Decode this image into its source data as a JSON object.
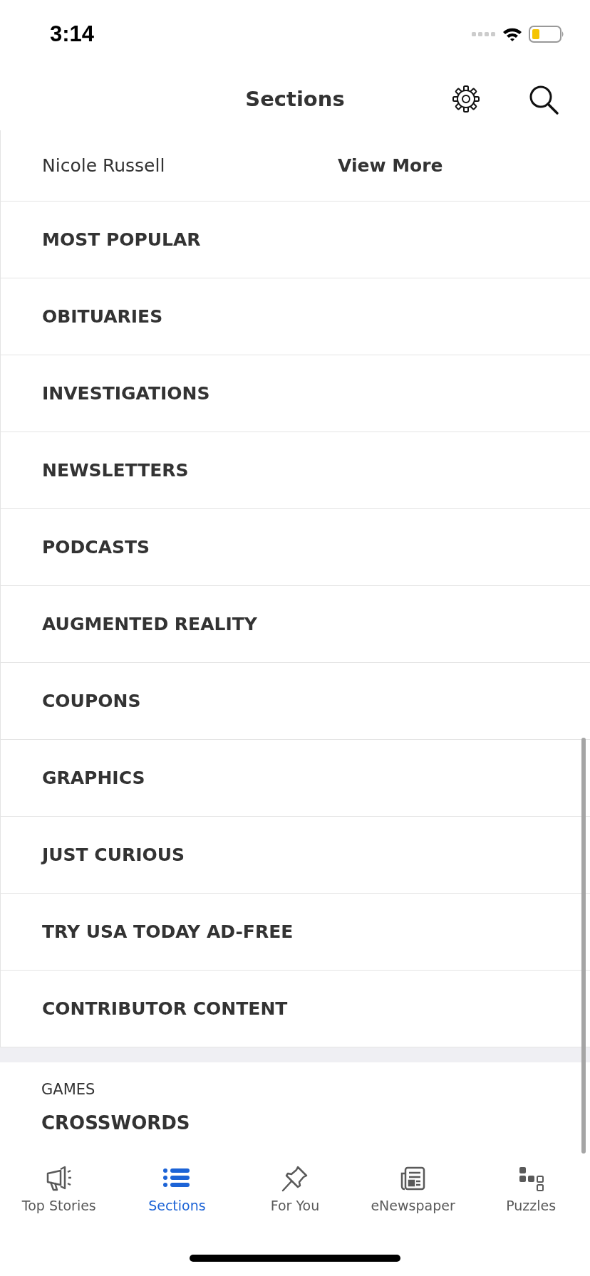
{
  "status_bar": {
    "time": "3:14"
  },
  "nav_bar": {
    "title": "Sections"
  },
  "partial_row": {
    "author": "Nicole Russell",
    "link": "View More"
  },
  "sections": [
    {
      "label": "MOST POPULAR"
    },
    {
      "label": "OBITUARIES"
    },
    {
      "label": "INVESTIGATIONS"
    },
    {
      "label": "NEWSLETTERS"
    },
    {
      "label": "PODCASTS"
    },
    {
      "label": "AUGMENTED REALITY"
    },
    {
      "label": "COUPONS"
    },
    {
      "label": "GRAPHICS"
    },
    {
      "label": "JUST CURIOUS"
    },
    {
      "label": "TRY USA TODAY AD-FREE"
    },
    {
      "label": "CONTRIBUTOR CONTENT"
    }
  ],
  "games": {
    "heading": "GAMES",
    "items": [
      {
        "label": "CROSSWORDS"
      }
    ]
  },
  "tab_bar": [
    {
      "label": "Top Stories",
      "selected": false
    },
    {
      "label": "Sections",
      "selected": true
    },
    {
      "label": "For You",
      "selected": false
    },
    {
      "label": "eNewspaper",
      "selected": false
    },
    {
      "label": "Puzzles",
      "selected": false
    }
  ]
}
